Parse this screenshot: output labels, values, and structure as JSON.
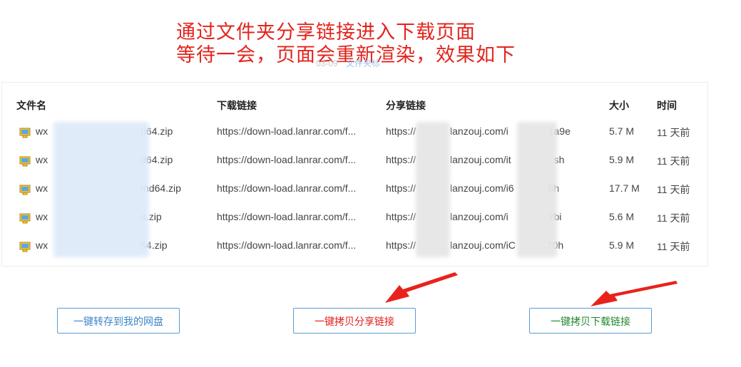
{
  "annotation": {
    "line1": "通过文件夹分享链接进入下载页面",
    "line2": "等待一会，页面会重新渲染，效果如下"
  },
  "sub_hint": {
    "text": "03-09",
    "link": "文件夹标"
  },
  "table": {
    "headers": {
      "name": "文件名",
      "download": "下载链接",
      "share": "分享链接",
      "size": "大小",
      "time": "时间"
    },
    "rows": [
      {
        "name_start": "wx",
        "name_end": "n64.zip",
        "download": "https://down-load.lanrar.com/f...",
        "share_pre": "https://",
        "share_mid": "lanzouj.com/i",
        "share_end": "1a9e",
        "size": "5.7 M",
        "time": "11 天前"
      },
      {
        "name_start": "wx",
        "name_end": "d64.zip",
        "download": "https://down-load.lanrar.com/f...",
        "share_pre": "https://",
        "share_mid": "lanzouj.com/it",
        "share_end": "sh",
        "size": "5.9 M",
        "time": "11 天前"
      },
      {
        "name_start": "wx",
        "name_end": "md64.zip",
        "download": "https://down-load.lanrar.com/f...",
        "share_pre": "https://",
        "share_mid": "lanzouj.com/i6",
        "share_end": "8h",
        "size": "17.7 M",
        "time": "11 天前"
      },
      {
        "name_start": "wx",
        "name_end": "4.zip",
        "download": "https://down-load.lanrar.com/f...",
        "share_pre": "https://",
        "share_mid": "lanzouj.com/i",
        "share_end": "7bi",
        "size": "5.6 M",
        "time": "11 天前"
      },
      {
        "name_start": "wx",
        "name_end": "54.zip",
        "download": "https://down-load.lanrar.com/f...",
        "share_pre": "https://",
        "share_mid": "lanzouj.com/iC",
        "share_end": "70h",
        "size": "5.9 M",
        "time": "11 天前"
      }
    ]
  },
  "buttons": {
    "save": "一键转存到我的网盘",
    "copy_share": "一键拷贝分享链接",
    "copy_download": "一键拷贝下载链接"
  },
  "colors": {
    "annotation": "#e2241c",
    "link": "#2d8cf0",
    "save_btn_text": "#3b86c7",
    "share_btn_text": "#e11c1c",
    "download_btn_text": "#22862f",
    "arrow": "#e8231b"
  },
  "icons": {
    "file": "zip-file-icon",
    "arrow": "red-pointer-arrow"
  }
}
